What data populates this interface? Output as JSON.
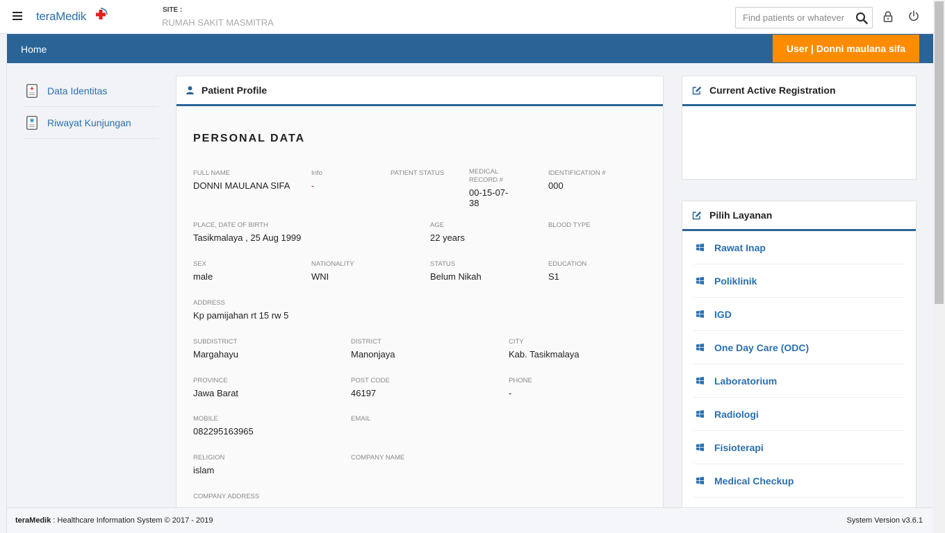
{
  "header": {
    "logo_text": "teraMedik",
    "site_label": "SITE :",
    "site_name": "RUMAH SAKIT MASMITRA",
    "search_placeholder": "Find patients or whatever"
  },
  "nav": {
    "home": "Home",
    "user": "User | Donni maulana sifa"
  },
  "sidebar": {
    "items": [
      {
        "label": "Data Identitas",
        "icon": "document-icon"
      },
      {
        "label": "Riwayat Kunjungan",
        "icon": "medical-document-icon"
      }
    ]
  },
  "profile": {
    "title": "Patient Profile",
    "section": "PERSONAL DATA",
    "fields": {
      "full_name": {
        "label": "FULL NAME",
        "value": "DONNI MAULANA SIFA"
      },
      "info": {
        "label": "Info",
        "value": "-"
      },
      "patient_status": {
        "label": "PATIENT STATUS",
        "value": ""
      },
      "medical_record": {
        "label": "MEDICAL RECORD #",
        "value": "00-15-07-38"
      },
      "identification": {
        "label": "IDENTIFICATION #",
        "value": "000"
      },
      "place_dob": {
        "label": "PLACE, DATE OF BIRTH",
        "value": "Tasikmalaya , 25 Aug 1999"
      },
      "age": {
        "label": "AGE",
        "value": "22 years"
      },
      "blood_type": {
        "label": "BLOOD TYPE",
        "value": ""
      },
      "sex": {
        "label": "SEX",
        "value": "male"
      },
      "nationality": {
        "label": "NATIONALITY",
        "value": "WNI"
      },
      "status": {
        "label": "STATUS",
        "value": "Belum Nikah"
      },
      "education": {
        "label": "EDUCATION",
        "value": "S1"
      },
      "address": {
        "label": "ADDRESS",
        "value": "Kp pamijahan rt 15 rw 5"
      },
      "subdistrict": {
        "label": "SUBDISTRICT",
        "value": "Margahayu"
      },
      "district": {
        "label": "DISTRICT",
        "value": "Manonjaya"
      },
      "city": {
        "label": "CITY",
        "value": "Kab. Tasikmalaya"
      },
      "province": {
        "label": "PROVINCE",
        "value": "Jawa Barat"
      },
      "post_code": {
        "label": "POST CODE",
        "value": "46197"
      },
      "phone": {
        "label": "PHONE",
        "value": "-"
      },
      "mobile": {
        "label": "MOBILE",
        "value": "082295163965"
      },
      "email": {
        "label": "EMAIL",
        "value": ""
      },
      "religion": {
        "label": "RELIGION",
        "value": "islam"
      },
      "company_name": {
        "label": "COMPANY NAME",
        "value": ""
      },
      "company_address": {
        "label": "COMPANY ADDRESS",
        "value": ""
      }
    }
  },
  "registration": {
    "title": "Current Active Registration"
  },
  "layanan": {
    "title": "Pilih Layanan",
    "items": [
      "Rawat Inap",
      "Poliklinik",
      "IGD",
      "One Day Care (ODC)",
      "Laboratorium",
      "Radiologi",
      "Fisioterapi",
      "Medical Checkup"
    ]
  },
  "footer": {
    "brand": "teraMedik",
    "text": " : Healthcare Information System © 2017 - 2019",
    "version": "System Version v3.6.1"
  },
  "colors": {
    "primary": "#2a6496",
    "accent": "#ff8c00",
    "link": "#2a6fb0"
  }
}
